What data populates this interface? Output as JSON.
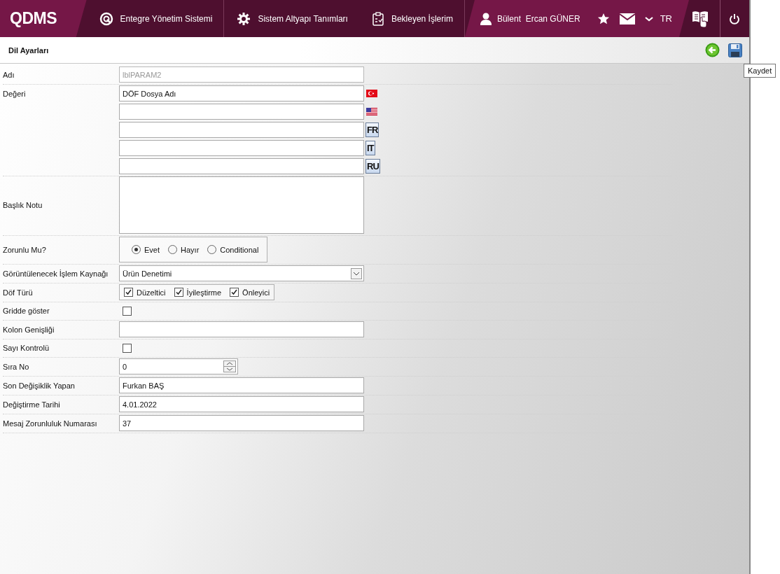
{
  "topbar": {
    "logo": "QDMS",
    "nav": [
      {
        "label": "Entegre Yönetim Sistemi"
      },
      {
        "label": "Sistem Altyapı Tanımları"
      },
      {
        "label": "Bekleyen İşlerim"
      }
    ],
    "user": "Bülent  Ercan GÜNER",
    "language": "TR"
  },
  "page": {
    "title": "Dil Ayarları",
    "tooltip": "Kaydet"
  },
  "rows": [
    {
      "kind": "text",
      "label": "Adı",
      "value": "lblPARAM2",
      "disabled": true
    },
    {
      "kind": "multilang",
      "label": "Değeri",
      "fields": [
        {
          "kind": "flag",
          "value": "DÖF Dosya Adı"
        },
        {
          "kind": "flag"
        },
        {
          "kind": "code",
          "code": "FR"
        },
        {
          "kind": "code",
          "code": "IT"
        },
        {
          "kind": "code",
          "code": "RU"
        }
      ]
    },
    {
      "kind": "textarea",
      "label": "Başlık Notu"
    },
    {
      "kind": "radio",
      "label": "Zorunlu Mu?",
      "options": [
        {
          "label": "Evet",
          "selected": true
        },
        {
          "label": "Hayır",
          "selected": false
        },
        {
          "label": "Conditional",
          "selected": false
        }
      ]
    },
    {
      "kind": "select",
      "label": "Görüntülenecek İşlem Kaynağı",
      "value": "Ürün Denetimi"
    },
    {
      "kind": "checks",
      "label": "Döf Türü",
      "options": [
        {
          "label": "Düzeltici",
          "checked": true
        },
        {
          "label": "İyileştirme",
          "checked": true
        },
        {
          "label": "Önleyici",
          "checked": true
        }
      ]
    },
    {
      "kind": "checkbox",
      "label": "Gridde göster",
      "checked": false
    },
    {
      "kind": "text",
      "label": "Kolon Genişliği"
    },
    {
      "kind": "checkbox",
      "label": "Sayı Kontrolü",
      "checked": false
    },
    {
      "kind": "spinner",
      "label": "Sıra No",
      "value": "0"
    },
    {
      "kind": "text",
      "label": "Son Değişiklik Yapan",
      "value": "Furkan BAŞ"
    },
    {
      "kind": "text",
      "label": "Değiştirme Tarihi",
      "value": "4.01.2022"
    },
    {
      "kind": "text",
      "label": "Mesaj Zorunluluk Numarası",
      "value": "37"
    }
  ]
}
